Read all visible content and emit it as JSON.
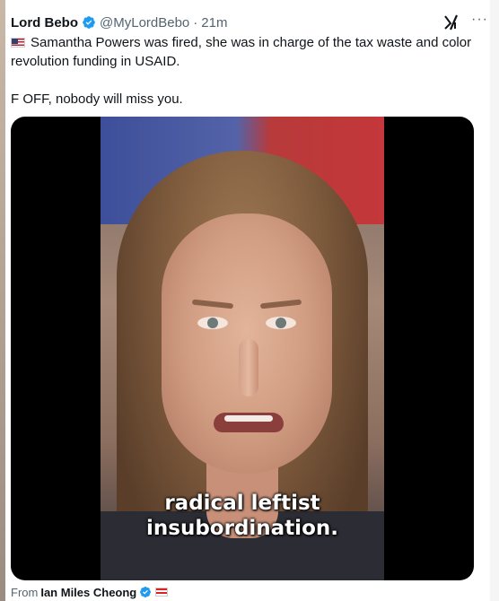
{
  "tweet": {
    "author_name": "Lord Bebo",
    "author_handle": "@MyLordBebo",
    "separator": "·",
    "time": "21m",
    "text_line1": "Samantha Powers was fired, she was in charge of the tax waste and color revolution funding in USAID.",
    "text_line2": "F OFF, nobody will miss you.",
    "more_glyph": "···"
  },
  "media": {
    "caption_line1": "radical leftist",
    "caption_line2": "insubordination."
  },
  "source": {
    "label": "From",
    "name": "Ian Miles Cheong"
  },
  "colors": {
    "verified_blue": "#1d9bf0",
    "text_primary": "#0f1419",
    "text_secondary": "#536471"
  },
  "icons": {
    "verified": "verified-badge-icon",
    "grok": "grok-icon",
    "more": "more-icon",
    "flag": "us-flag-icon"
  }
}
